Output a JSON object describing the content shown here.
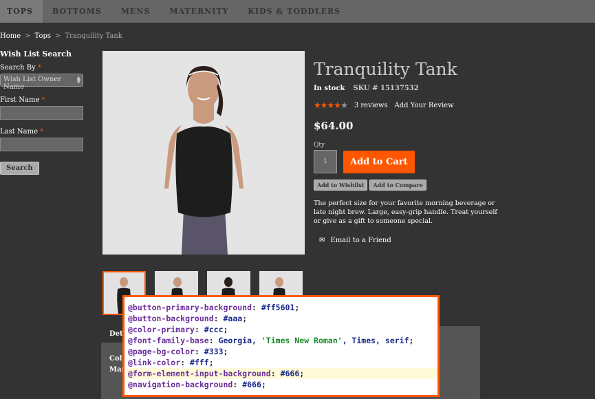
{
  "nav": {
    "items": [
      {
        "label": "TOPS",
        "active": true
      },
      {
        "label": "BOTTOMS",
        "active": false
      },
      {
        "label": "MENS",
        "active": false
      },
      {
        "label": "MATERNITY",
        "active": false
      },
      {
        "label": "KIDS & TODDLERS",
        "active": false
      }
    ]
  },
  "breadcrumb": {
    "home": "Home",
    "category": "Tops",
    "current": "Tranquility Tank",
    "separator": ">"
  },
  "sidebar": {
    "title": "Wish List Search",
    "search_by_label": "Search By",
    "search_by_value": "Wish List Owner Name",
    "first_name_label": "First Name",
    "last_name_label": "Last Name",
    "required_mark": "*",
    "search_button": "Search"
  },
  "product": {
    "title": "Tranquility Tank",
    "stock": "In stock",
    "sku": "SKU # 15137532",
    "rating": {
      "value": 4,
      "max": 5
    },
    "reviews_link": "3 reviews",
    "add_review_link": "Add Your Review",
    "price": "$64.00",
    "qty_label": "Qty",
    "qty_value": "1",
    "add_to_cart": "Add to Cart",
    "add_to_wishlist": "Add to Wishlist",
    "add_to_compare": "Add to Compare",
    "description": "The perfect size for your favorite morning beverage or late night brew. Large, easy-grip handle. Treat yourself or give as a gift to someone special.",
    "email_friend": "Email to a Friend"
  },
  "tabs": {
    "active_label": "Det",
    "content_lines": [
      "Col",
      "Mar"
    ]
  },
  "code": {
    "lines": [
      {
        "var": "@button-primary-background",
        "value": "#ff5601",
        "type": "val"
      },
      {
        "var": "@button-background",
        "value": "#aaa",
        "type": "val"
      },
      {
        "var": "@color-primary",
        "value": "#ccc",
        "type": "val"
      },
      {
        "var": "@font-family-base",
        "value": "Georgia, 'Times New Roman', Times, serif",
        "type": "font"
      },
      {
        "var": "@page-bg-color",
        "value": "#333",
        "type": "val"
      },
      {
        "var": "@link-color",
        "value": "#fff",
        "type": "val"
      },
      {
        "var": "@form-element-input-background",
        "value": "#666",
        "type": "val",
        "highlight": true
      },
      {
        "var": "@navigation-background",
        "value": "#666",
        "type": "val"
      }
    ]
  },
  "colors": {
    "accent": "#ff5601",
    "page_bg": "#333",
    "nav_bg": "#666",
    "button_bg": "#aaa",
    "primary_text": "#ccc"
  }
}
